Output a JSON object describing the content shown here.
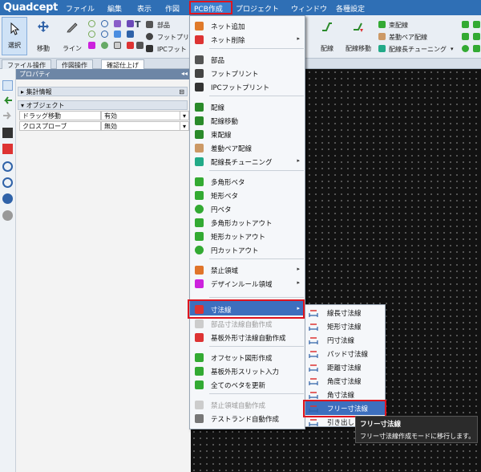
{
  "app": {
    "logo": "Quadcept"
  },
  "menubar": {
    "items": [
      "ファイル",
      "編集",
      "表示",
      "作図",
      "PCB作成",
      "プロジェクト",
      "ウィンドウ",
      "各種設定"
    ],
    "active": "PCB作成"
  },
  "ribbon": {
    "select": "選択",
    "move": "移動",
    "line": "ライン",
    "part_small": "部品",
    "footprint_small": "フットプリ",
    "ipc_small": "IPCフット",
    "route": "配線",
    "route_move": "配線移動",
    "bundle": "束配線",
    "diff_pair": "差動ペア配線",
    "length_tune": "配線長チューニング"
  },
  "tabs": [
    "ファイル操作",
    "作図操作",
    "確認仕上げ"
  ],
  "panel": {
    "title": "プロパティ",
    "pin_glyph": "◂◂",
    "sections": {
      "summary": "集計情報",
      "object": "オブジェクト"
    },
    "summary_close": "⊟",
    "rows": [
      {
        "name": "ドラッグ移動",
        "value": "有効"
      },
      {
        "name": "クロスプローブ",
        "value": "無効"
      }
    ]
  },
  "dropdown": {
    "items": [
      {
        "label": "ネット追加",
        "icon": "net-add-icon",
        "arrow": false,
        "disabled": false
      },
      {
        "label": "ネット削除",
        "icon": "net-delete-icon",
        "arrow": true,
        "disabled": false
      },
      {
        "label": "部品",
        "icon": "part-icon",
        "arrow": false,
        "disabled": false
      },
      {
        "label": "フットプリント",
        "icon": "footprint-icon",
        "arrow": false,
        "disabled": false
      },
      {
        "label": "IPCフットプリント",
        "icon": "ipc-footprint-icon",
        "arrow": false,
        "disabled": false
      },
      {
        "label": "配線",
        "icon": "route-icon",
        "arrow": false,
        "disabled": false
      },
      {
        "label": "配線移動",
        "icon": "route-move-icon",
        "arrow": false,
        "disabled": false
      },
      {
        "label": "束配線",
        "icon": "bundle-route-icon",
        "arrow": false,
        "disabled": false
      },
      {
        "label": "差動ペア配線",
        "icon": "diff-pair-icon",
        "arrow": false,
        "disabled": false
      },
      {
        "label": "配線長チューニング",
        "icon": "length-tune-icon",
        "arrow": true,
        "disabled": false
      },
      {
        "label": "多角形ベタ",
        "icon": "polygon-fill-icon",
        "arrow": false,
        "disabled": false
      },
      {
        "label": "矩形ベタ",
        "icon": "rect-fill-icon",
        "arrow": false,
        "disabled": false
      },
      {
        "label": "円ベタ",
        "icon": "circle-fill-icon",
        "arrow": false,
        "disabled": false
      },
      {
        "label": "多角形カットアウト",
        "icon": "polygon-cutout-icon",
        "arrow": false,
        "disabled": false
      },
      {
        "label": "矩形カットアウト",
        "icon": "rect-cutout-icon",
        "arrow": false,
        "disabled": false
      },
      {
        "label": "円カットアウト",
        "icon": "circle-cutout-icon",
        "arrow": false,
        "disabled": false
      },
      {
        "label": "禁止領域",
        "icon": "keepout-icon",
        "arrow": true,
        "disabled": false
      },
      {
        "label": "デザインルール領域",
        "icon": "design-rule-icon",
        "arrow": true,
        "disabled": false
      },
      {
        "label": "寸法線",
        "icon": "dimension-icon",
        "arrow": true,
        "disabled": false,
        "highlighted": true
      },
      {
        "label": "部品寸法線自動作成",
        "icon": "auto-part-dimension-icon",
        "arrow": false,
        "disabled": true
      },
      {
        "label": "基板外形寸法線自動作成",
        "icon": "auto-board-dimension-icon",
        "arrow": false,
        "disabled": false
      },
      {
        "label": "オフセット図形作成",
        "icon": "offset-shape-icon",
        "arrow": false,
        "disabled": false
      },
      {
        "label": "基板外形スリット入力",
        "icon": "board-slit-icon",
        "arrow": false,
        "disabled": false
      },
      {
        "label": "全てのベタを更新",
        "icon": "refresh-fill-icon",
        "arrow": false,
        "disabled": false
      },
      {
        "label": "禁止領域自動作成",
        "icon": "auto-keepout-icon",
        "arrow": false,
        "disabled": true
      },
      {
        "label": "テストランド自動作成",
        "icon": "test-land-icon",
        "arrow": false,
        "disabled": false
      }
    ]
  },
  "submenu": {
    "items": [
      {
        "label": "線長寸法線",
        "icon": "length-dim-icon"
      },
      {
        "label": "矩形寸法線",
        "icon": "rect-dim-icon"
      },
      {
        "label": "円寸法線",
        "icon": "circle-dim-icon"
      },
      {
        "label": "パッド寸法線",
        "icon": "pad-dim-icon"
      },
      {
        "label": "距離寸法線",
        "icon": "distance-dim-icon"
      },
      {
        "label": "角度寸法線",
        "icon": "angle-dim-icon"
      },
      {
        "label": "角寸法線",
        "icon": "corner-dim-icon"
      },
      {
        "label": "フリー寸法線",
        "icon": "free-dim-icon",
        "highlighted": true
      },
      {
        "label": "引き出し",
        "icon": "leader-icon"
      }
    ]
  },
  "tooltip": {
    "title": "フリー寸法線",
    "description": "フリー寸法線作成モードに移行します。"
  },
  "colors": {
    "menubar_bg": "#2f6fb5",
    "highlight": "#3d6fbe",
    "annotation_red": "#e0141e",
    "canvas_bg": "#121212"
  }
}
